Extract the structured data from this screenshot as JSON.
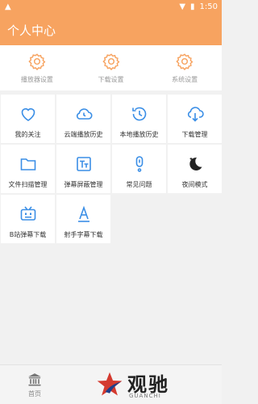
{
  "status_bar": {
    "time": "1:50"
  },
  "header": {
    "title": "个人中心"
  },
  "settings": [
    {
      "label": "播放器设置",
      "icon": "gear-icon"
    },
    {
      "label": "下载设置",
      "icon": "gear-icon"
    },
    {
      "label": "系统设置",
      "icon": "gear-icon"
    }
  ],
  "tiles": [
    {
      "label": "我的关注",
      "icon": "heart-icon"
    },
    {
      "label": "云端播放历史",
      "icon": "cloud-clock-icon"
    },
    {
      "label": "本地播放历史",
      "icon": "history-clock-icon"
    },
    {
      "label": "下载管理",
      "icon": "cloud-download-icon"
    },
    {
      "label": "文件扫描管理",
      "icon": "folder-icon"
    },
    {
      "label": "弹幕屏蔽管理",
      "icon": "text-block-icon"
    },
    {
      "label": "常见问题",
      "icon": "info-icon"
    },
    {
      "label": "夜间模式",
      "icon": "moon-icon"
    },
    {
      "label": "B站弹幕下载",
      "icon": "tv-download-icon"
    },
    {
      "label": "射手字幕下载",
      "icon": "subtitle-a-icon"
    }
  ],
  "bottom_nav": {
    "home_label": "首页"
  },
  "watermark": {
    "brand": "观驰",
    "sub": "GUANCHI"
  },
  "colors": {
    "accent": "#f7a360",
    "icon_blue": "#3a8ee6",
    "background": "#f1f1f1"
  }
}
